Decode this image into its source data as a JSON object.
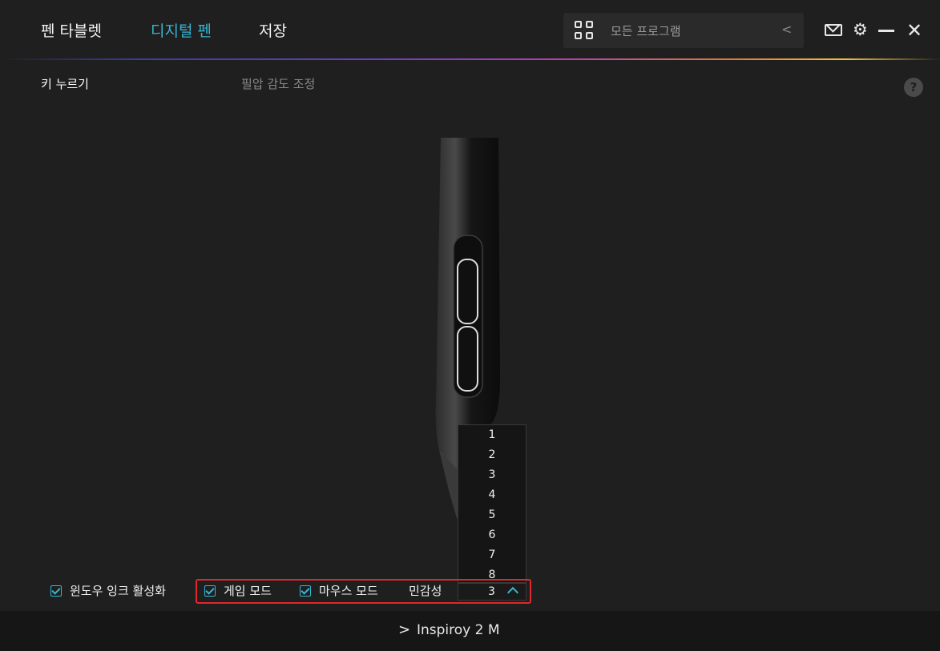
{
  "nav": {
    "tabs": [
      {
        "label": "펜 타블렛",
        "active": false
      },
      {
        "label": "디지털 펜",
        "active": true
      },
      {
        "label": "저장",
        "active": false
      }
    ]
  },
  "program_selector": {
    "icon": "grid-icon",
    "label": "모든 프로그램",
    "chevron": "<"
  },
  "window_controls": {
    "mail": "mail-icon",
    "settings": "gear-icon",
    "minimize": "minimize-icon",
    "close": "close-icon",
    "close_glyph": "✕",
    "gear_glyph": "⚙"
  },
  "subtabs": [
    {
      "label": "키 누르기",
      "active": true
    },
    {
      "label": "필압 감도 조정",
      "active": false
    }
  ],
  "help": {
    "glyph": "?"
  },
  "options": {
    "windows_ink": {
      "label": "윈도우 잉크 활성화",
      "checked": true
    },
    "game_mode": {
      "label": "게임 모드",
      "checked": true
    },
    "mouse_mode": {
      "label": "마우스 모드",
      "checked": true
    },
    "sensitivity_label": "민감성",
    "sensitivity_value": "3",
    "sensitivity_options": [
      "1",
      "2",
      "3",
      "4",
      "5",
      "6",
      "7",
      "8"
    ]
  },
  "footer": {
    "chevron": ">",
    "device": "Inspiroy 2 M"
  },
  "colors": {
    "accent": "#36b6d3",
    "highlight_box": "#e0282b",
    "background": "#1f1f1f"
  }
}
